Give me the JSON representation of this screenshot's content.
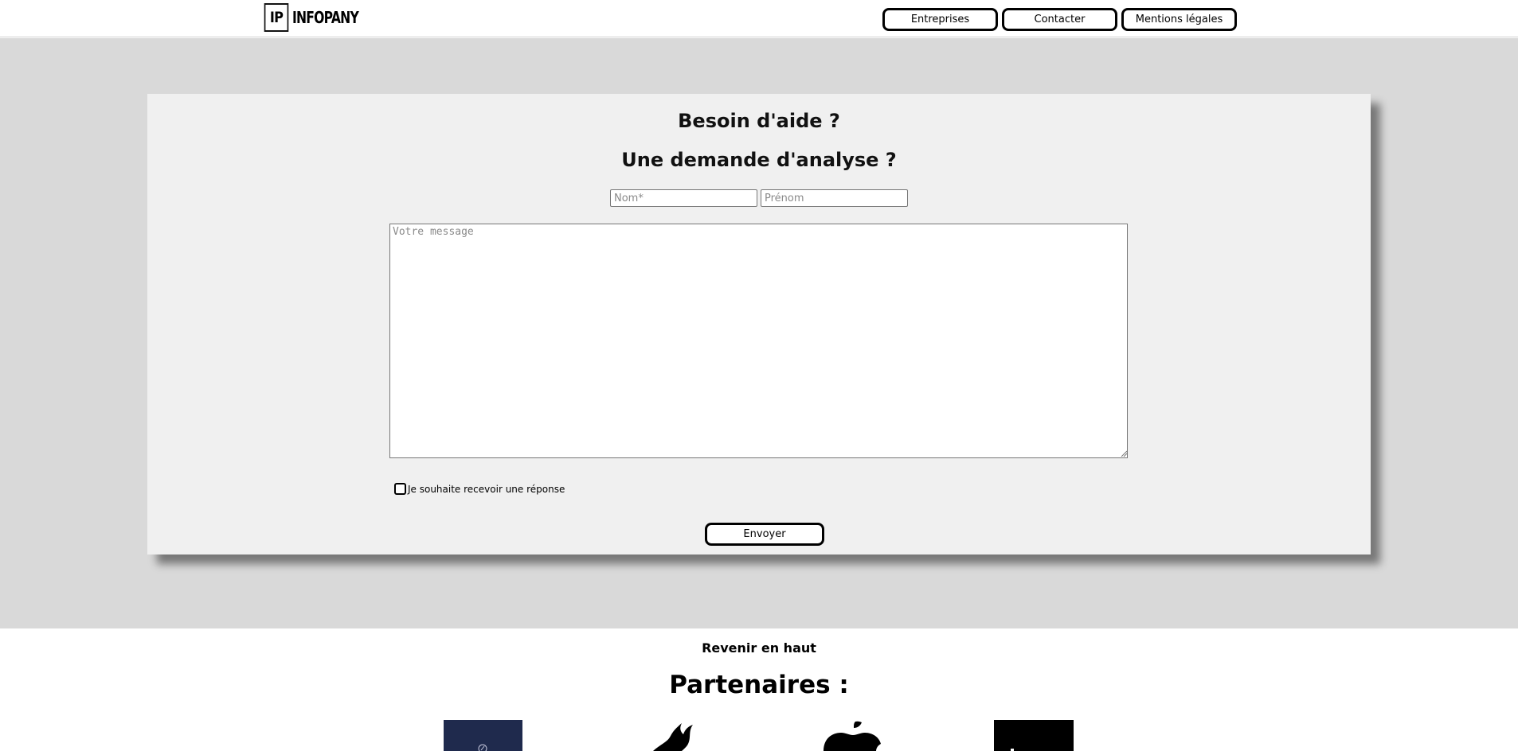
{
  "header": {
    "logo_mark": "IP",
    "logo_text": "INFOPANY",
    "nav": [
      {
        "label": "Entreprises"
      },
      {
        "label": "Contacter"
      },
      {
        "label": "Mentions légales"
      }
    ]
  },
  "form": {
    "title": "Besoin d'aide ?",
    "subtitle": "Une demande d'analyse ?",
    "nom_placeholder": "Nom*",
    "prenom_placeholder": "Prénom",
    "message_placeholder": "Votre message",
    "checkbox_label": "Je souhaite recevoir une réponse",
    "checkbox_checked": false,
    "submit_label": "Envoyer"
  },
  "footer": {
    "back_to_top": "Revenir en haut",
    "partners_title": "Partenaires :",
    "partners": [
      {
        "icon": "navy-badge-logo"
      },
      {
        "icon": "flame-logo"
      },
      {
        "icon": "apple-logo"
      },
      {
        "icon": "black-square-logo"
      }
    ]
  },
  "colors": {
    "band_background": "#d9d9d9",
    "card_background": "#f0f0f0",
    "partner1_background": "#1f2a4d",
    "partner4_background": "#000000"
  }
}
